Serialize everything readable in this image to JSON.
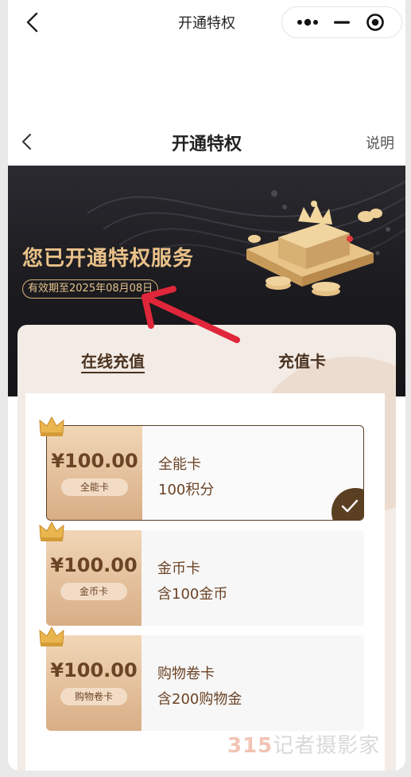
{
  "mini_program": {
    "title": "开通特权"
  },
  "nav": {
    "title": "开通特权",
    "help": "说明"
  },
  "hero": {
    "title": "您已开通特权服务",
    "validity": "有效期至2025年08月08日"
  },
  "tabs": [
    {
      "label": "在线充值",
      "active": true
    },
    {
      "label": "充值卡",
      "active": false
    }
  ],
  "cards": [
    {
      "price": "¥100.00",
      "tag": "全能卡",
      "name": "全能卡",
      "desc": "100积分",
      "selected": true
    },
    {
      "price": "¥100.00",
      "tag": "金币卡",
      "name": "金币卡",
      "desc": "含100金币",
      "selected": false
    },
    {
      "price": "¥100.00",
      "tag": "购物卷卡",
      "name": "购物卷卡",
      "desc": "含200购物金",
      "selected": false
    }
  ],
  "watermark": {
    "number": "315",
    "text": "记者摄影家"
  },
  "colors": {
    "gold": "#e9c189",
    "brown": "#6b4325",
    "arrow": "#e0263a"
  }
}
